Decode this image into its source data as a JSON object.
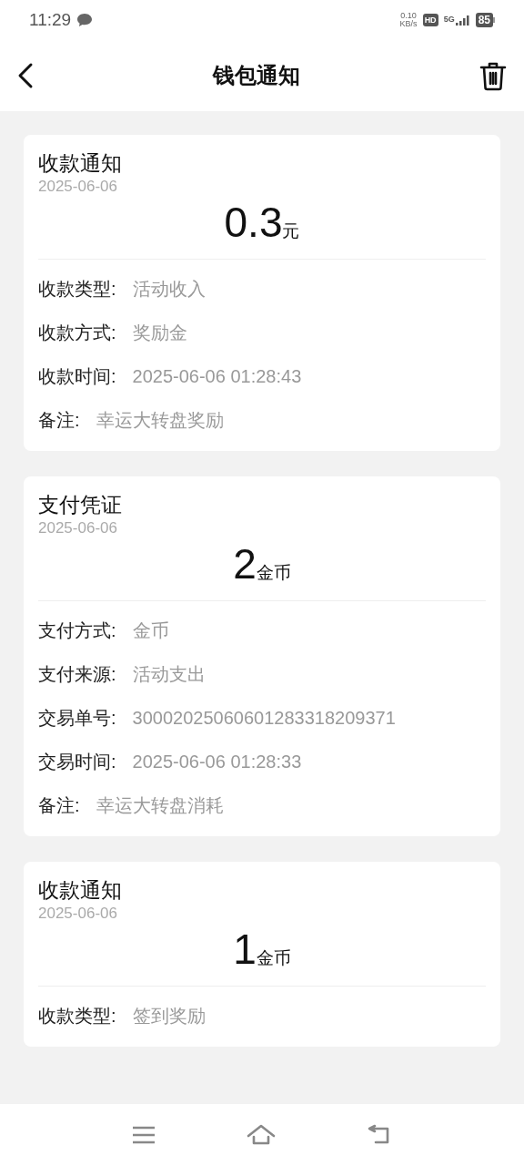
{
  "status_bar": {
    "time": "11:29",
    "net_speed": "0.10",
    "net_unit": "KB/s",
    "hd": "HD",
    "network": "5G",
    "battery": "85"
  },
  "header": {
    "title": "钱包通知"
  },
  "cards": [
    {
      "title": "收款通知",
      "date": "2025-06-06",
      "amount": "0.3",
      "unit": "元",
      "rows": [
        {
          "label": "收款类型:",
          "value": "活动收入"
        },
        {
          "label": "收款方式:",
          "value": "奖励金"
        },
        {
          "label": "收款时间:",
          "value": "2025-06-06 01:28:43"
        },
        {
          "label": "备注:",
          "value": "幸运大转盘奖励"
        }
      ]
    },
    {
      "title": "支付凭证",
      "date": "2025-06-06",
      "amount": "2",
      "unit": "金币",
      "rows": [
        {
          "label": "支付方式:",
          "value": "金币"
        },
        {
          "label": "支付来源:",
          "value": "活动支出"
        },
        {
          "label": "交易单号:",
          "value": "30002025060601283318209371"
        },
        {
          "label": "交易时间:",
          "value": "2025-06-06 01:28:33"
        },
        {
          "label": "备注:",
          "value": "幸运大转盘消耗"
        }
      ]
    },
    {
      "title": "收款通知",
      "date": "2025-06-06",
      "amount": "1",
      "unit": "金币",
      "rows": [
        {
          "label": "收款类型:",
          "value": "签到奖励"
        }
      ]
    }
  ]
}
